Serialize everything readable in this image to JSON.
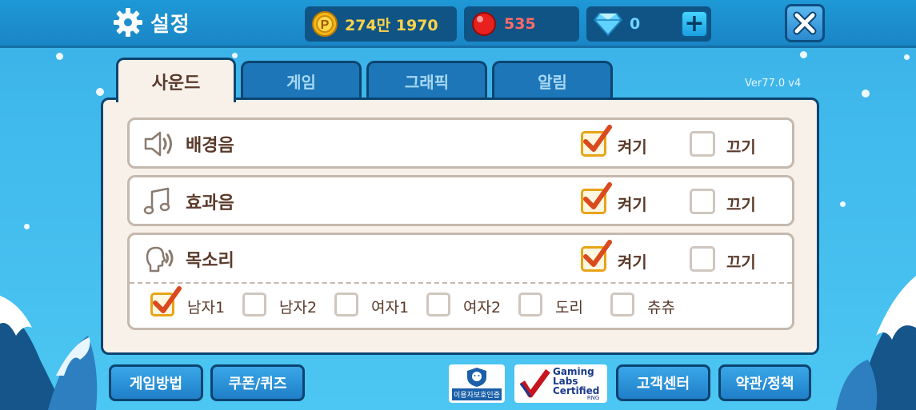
{
  "header": {
    "title": "설정",
    "coins": "274만 1970",
    "gems": "535",
    "diamonds": "0",
    "plus_label": "+"
  },
  "tabs": [
    {
      "label": "사운드",
      "active": true
    },
    {
      "label": "게임",
      "active": false
    },
    {
      "label": "그래픽",
      "active": false
    },
    {
      "label": "알림",
      "active": false
    }
  ],
  "version": "Ver77.0 v4",
  "settings": [
    {
      "label": "배경음",
      "icon": "speaker-icon",
      "on_label": "켜기",
      "off_label": "끄기",
      "on": true
    },
    {
      "label": "효과음",
      "icon": "music-note-icon",
      "on_label": "켜기",
      "off_label": "끄기",
      "on": true
    },
    {
      "label": "목소리",
      "icon": "voice-head-icon",
      "on_label": "켜기",
      "off_label": "끄기",
      "on": true
    }
  ],
  "voice_options": [
    {
      "label": "남자1",
      "checked": true
    },
    {
      "label": "남자2",
      "checked": false
    },
    {
      "label": "여자1",
      "checked": false
    },
    {
      "label": "여자2",
      "checked": false
    },
    {
      "label": "도리",
      "checked": false
    },
    {
      "label": "츄츄",
      "checked": false
    }
  ],
  "footer": {
    "how_to_play": "게임방법",
    "coupon_quiz": "쿠폰/퀴즈",
    "privacy_badge": "이용자보호인증",
    "gaming_labs_line1": "Gaming",
    "gaming_labs_line2": "Labs",
    "gaming_labs_line3": "Certified",
    "gaming_labs_rng": "RNG",
    "support": "고객센터",
    "terms": "약관/정책"
  },
  "colors": {
    "accent": "#1c76b8",
    "panel": "#f7f1ea",
    "check": "#e8a417",
    "tick": "#d94a1e",
    "text": "#5a3a2a"
  }
}
